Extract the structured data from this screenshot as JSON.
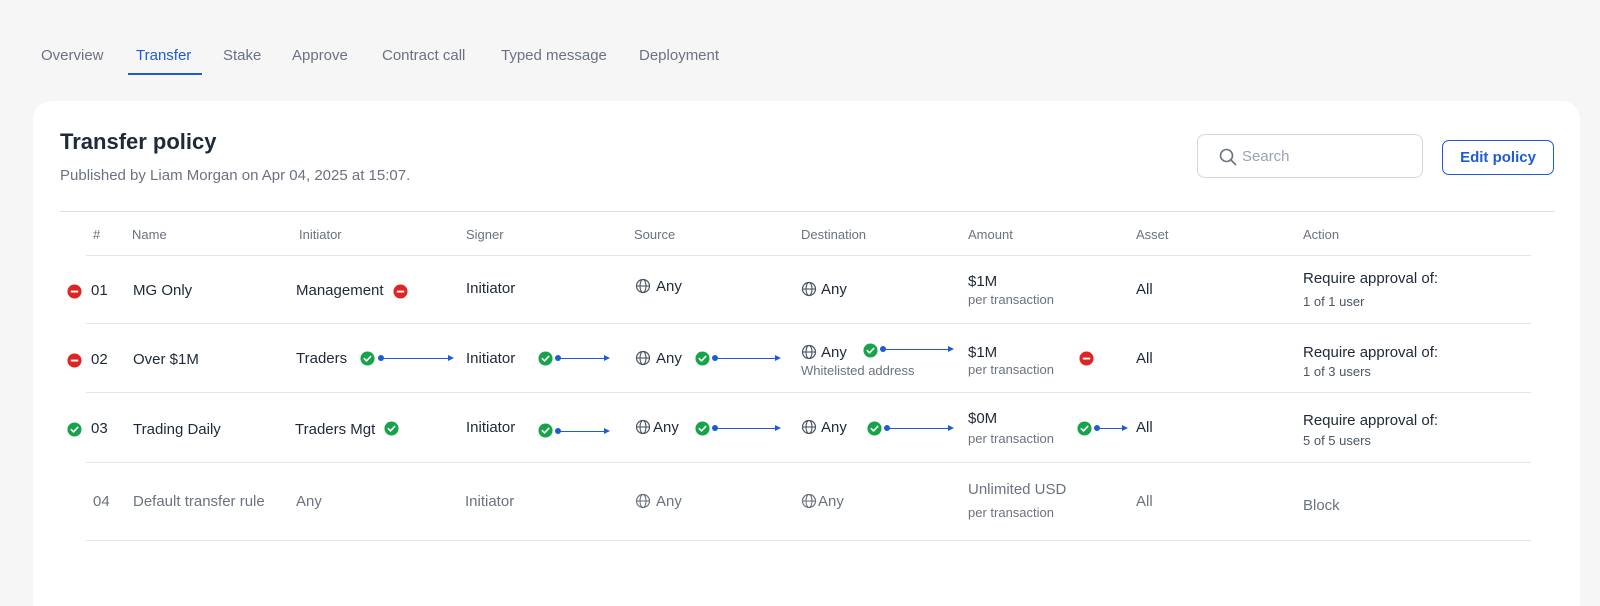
{
  "tabs": [
    {
      "label": "Overview"
    },
    {
      "label": "Transfer",
      "active": true
    },
    {
      "label": "Stake"
    },
    {
      "label": "Approve"
    },
    {
      "label": "Contract call"
    },
    {
      "label": "Typed message"
    },
    {
      "label": "Deployment"
    }
  ],
  "policy": {
    "title": "Transfer policy",
    "published": "Published by Liam Morgan on Apr 04, 2025 at 15:07."
  },
  "search": {
    "placeholder": "Search",
    "value": ""
  },
  "edit_label": "Edit policy",
  "columns": [
    "#",
    "Name",
    "Initiator",
    "Signer",
    "Source",
    "Destination",
    "Amount",
    "Asset",
    "Action"
  ],
  "rows": [
    {
      "status": "block",
      "num": "01",
      "name": "MG Only",
      "initiator": "Management",
      "signer": "Initiator",
      "source": "Any",
      "destination": "Any",
      "amount": "$1M",
      "amount_sub": "per transaction",
      "asset": "All",
      "action": "Require approval of:",
      "action_sub": "1 of 1 user"
    },
    {
      "status": "block",
      "num": "02",
      "name": "Over $1M",
      "initiator": "Traders",
      "signer": "Initiator",
      "source": "Any",
      "destination": "Any",
      "destination_sub": "Whitelisted address",
      "amount": "$1M",
      "amount_sub": "per transaction",
      "asset": "All",
      "action": "Require approval of:",
      "action_sub": "1 of 3 users"
    },
    {
      "status": "allow",
      "num": "03",
      "name": "Trading Daily",
      "initiator": "Traders Mgt",
      "signer": "Initiator",
      "source": "Any",
      "destination": "Any",
      "amount": "$0M",
      "amount_sub": "per transaction",
      "asset": "All",
      "action": "Require approval of:",
      "action_sub": "5 of 5 users"
    },
    {
      "status": "none",
      "num": "04",
      "name": "Default transfer rule",
      "initiator": "Any",
      "signer": "Initiator",
      "source": "Any",
      "destination": "Any",
      "amount": "Unlimited USD",
      "amount_sub": "per transaction",
      "asset": "All",
      "action": "Block"
    }
  ],
  "colors": {
    "accent": "#1e5bd6",
    "allow": "#16a34a",
    "block": "#dc2626"
  },
  "icons": {
    "allow": "check-circle-icon",
    "block": "minus-circle-icon",
    "globe": "globe-icon",
    "search": "search-icon"
  }
}
